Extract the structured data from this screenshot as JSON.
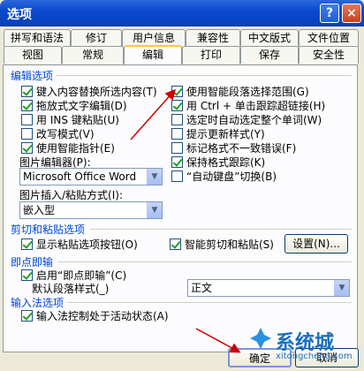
{
  "window": {
    "title": "选项",
    "help_glyph": "?",
    "close_glyph": "×"
  },
  "tabs_row1": [
    "拼写和语法",
    "修订",
    "用户信息",
    "兼容性",
    "中文版式",
    "文件位置"
  ],
  "tabs_row2": [
    "视图",
    "常规",
    "编辑",
    "打印",
    "保存",
    "安全性"
  ],
  "active_tab": "编辑",
  "edit_options": {
    "title": "编辑选项",
    "left": [
      {
        "label": "键入内容替换所选内容(T)",
        "checked": true
      },
      {
        "label": "拖放式文字编辑(D)",
        "checked": true
      },
      {
        "label": "用 INS 键粘贴(U)",
        "checked": false
      },
      {
        "label": "改写模式(V)",
        "checked": false
      },
      {
        "label": "使用智能指针(E)",
        "checked": true
      }
    ],
    "right": [
      {
        "label": "使用智能段落选择范围(G)",
        "checked": true
      },
      {
        "label": "用 Ctrl + 单击跟踪超链接(H)",
        "checked": true
      },
      {
        "label": "选定时自动选定整个单词(W)",
        "checked": false
      },
      {
        "label": "提示更新样式(Y)",
        "checked": false
      },
      {
        "label": "标记格式不一致错误(F)",
        "checked": false
      },
      {
        "label": "保持格式跟踪(K)",
        "checked": true
      },
      {
        "label": "“自动键盘”切换(B)",
        "checked": false
      }
    ],
    "picture_editor_label": "图片编辑器(P):",
    "picture_editor_value": "Microsoft Office Word",
    "insert_paste_label": "图片插入/粘贴方式(I):",
    "insert_paste_value": "嵌入型"
  },
  "cut_paste": {
    "title": "剪切和粘贴选项",
    "show_paste_buttons": {
      "label": "显示粘贴选项按钮(O)",
      "checked": true
    },
    "smart_cut_paste": {
      "label": "智能剪切和粘贴(S)",
      "checked": true
    },
    "settings_button": "设置(N)..."
  },
  "click_and_type": {
    "title": "即点即输",
    "enable": {
      "label": "启用“即点即输”(C)",
      "checked": true
    },
    "default_style_label": "默认段落样式(_)",
    "default_style_value": "正文"
  },
  "ime": {
    "title": "输入法选项",
    "ime_control": {
      "label": "输入法控制处于活动状态(A)",
      "checked": true
    }
  },
  "buttons": {
    "ok": "确定",
    "cancel": "取消"
  },
  "watermark": {
    "text": "系统城",
    "sub": "xitongcheng.com"
  },
  "colors": {
    "title_bar": "#0a4ad0",
    "section_title": "#0046d5",
    "annotation_arrow": "#cc0000"
  }
}
